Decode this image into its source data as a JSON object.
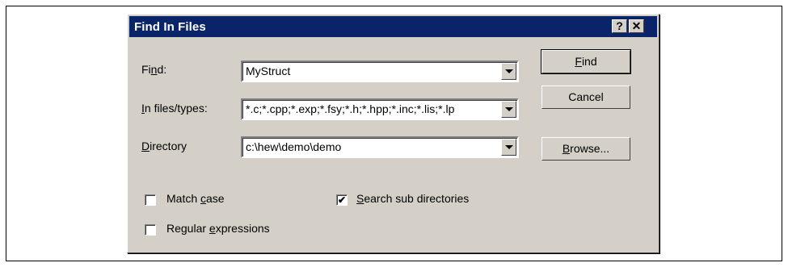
{
  "dialog": {
    "title": "Find In Files",
    "help_label": "?",
    "close_label": "✕"
  },
  "find": {
    "label_pre": "Fi",
    "label_key": "n",
    "label_post": "d:",
    "value": "MyStruct"
  },
  "types": {
    "label_key": "I",
    "label_post": "n files/types:",
    "value": "*.c;*.cpp;*.exp;*.fsy;*.h;*.hpp;*.inc;*.lis;*.lp"
  },
  "directory": {
    "label_key": "D",
    "label_post": "irectory",
    "value": "c:\\hew\\demo\\demo"
  },
  "buttons": {
    "find_key": "F",
    "find_post": "ind",
    "cancel": "Cancel",
    "browse_key": "B",
    "browse_post": "rowse..."
  },
  "options": {
    "match_case_pre": "Match ",
    "match_case_key": "c",
    "match_case_post": "ase",
    "match_case_checked": false,
    "regex_pre": "Regular ",
    "regex_key": "e",
    "regex_post": "xpressions",
    "regex_checked": false,
    "subdirs_key": "S",
    "subdirs_post": "earch sub directories",
    "subdirs_checked": true,
    "check_mark": "✔"
  }
}
